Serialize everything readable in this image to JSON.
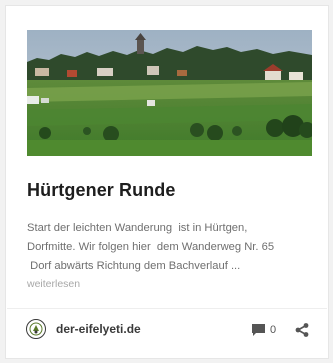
{
  "post": {
    "image_alt": "Hürtgen landscape",
    "title": "Hürtgener Runde",
    "excerpt_lines": [
      "Start der leichten Wanderung  ist in Hürtgen,",
      "Dorfmitte. Wir folgen hier  dem Wanderweg Nr. 65",
      " Dorf abwärts Richtung dem Bachverlauf ..."
    ],
    "read_more": "weiterlesen"
  },
  "footer": {
    "author": "der-eifelyeti.de",
    "comment_count": "0",
    "comment_icon": "comment-icon",
    "share_icon": "share-icon",
    "avatar_icon": "yeti-logo-icon"
  },
  "colors": {
    "title": "#1e1e1e",
    "excerpt": "#6f6f6f",
    "read_more": "#a8a8a8",
    "meta": "#3a3a3a"
  }
}
